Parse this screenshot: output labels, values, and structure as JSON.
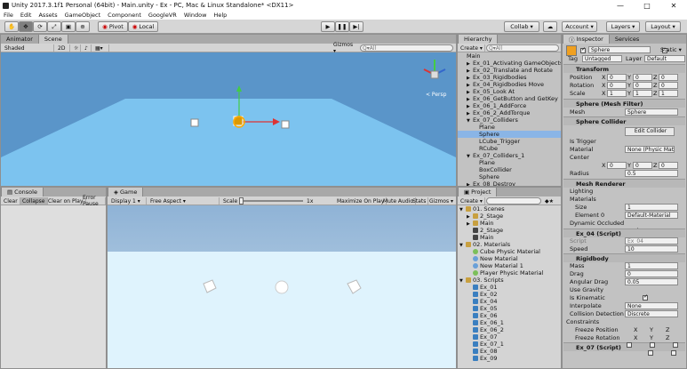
{
  "window": {
    "title": "Unity 2017.3.1f1 Personal (64bit) - Main.unity - Ex - PC, Mac & Linux Standalone* <DX11>"
  },
  "menu": [
    "File",
    "Edit",
    "Assets",
    "GameObject",
    "Component",
    "GoogleVR",
    "Window",
    "Help"
  ],
  "toolbar": {
    "pivot": "Pivot",
    "local": "Local",
    "collab": "Collab ▾",
    "account": "Account ▾",
    "layers": "Layers ▾",
    "layout": "Layout ▾"
  },
  "scene": {
    "tabs": [
      "Animator",
      "Scene"
    ],
    "shading": "Shaded",
    "mode2d": "2D",
    "gizmos": "Gizmos ▾",
    "search_placeholder": "Q▾All",
    "persp": "< Persp"
  },
  "console": {
    "tab": "Console",
    "buttons": [
      "Clear",
      "Collapse",
      "Clear on Play",
      "Error Pause"
    ]
  },
  "game": {
    "tab": "Game",
    "display": "Display 1 ▾",
    "aspect": "Free Aspect ▾",
    "scale_label": "Scale",
    "scale_value": "1x",
    "buttons": [
      "Maximize On Play",
      "Mute Audio",
      "Stats",
      "Gizmos ▾"
    ]
  },
  "hierarchy": {
    "tab": "Hierarchy",
    "create": "Create ▾",
    "search_placeholder": "Q▾All",
    "items": [
      {
        "label": "Main",
        "indent": 0,
        "arrow": ""
      },
      {
        "label": "Ex_01_Activating GameObjects",
        "indent": 1,
        "arrow": "▶"
      },
      {
        "label": "Ex_02_Translate and Rotate",
        "indent": 1,
        "arrow": "▶"
      },
      {
        "label": "Ex_03_Rigidbodies",
        "indent": 1,
        "arrow": "▶"
      },
      {
        "label": "Ex_04_Rigidbodies Move",
        "indent": 1,
        "arrow": "▶"
      },
      {
        "label": "Ex_05_Look At",
        "indent": 1,
        "arrow": "▶"
      },
      {
        "label": "Ex_06_GetButton and GetKey",
        "indent": 1,
        "arrow": "▶"
      },
      {
        "label": "Ex_06_1_AddForce",
        "indent": 1,
        "arrow": "▶"
      },
      {
        "label": "Ex_06_2_AddTorque",
        "indent": 1,
        "arrow": "▶"
      },
      {
        "label": "Ex_07_Colliders",
        "indent": 1,
        "arrow": "▼"
      },
      {
        "label": "Plane",
        "indent": 2,
        "arrow": ""
      },
      {
        "label": "Sphere",
        "indent": 2,
        "arrow": "",
        "selected": true
      },
      {
        "label": "LCube_Trigger",
        "indent": 2,
        "arrow": ""
      },
      {
        "label": "RCube",
        "indent": 2,
        "arrow": ""
      },
      {
        "label": "Ex_07_Colliders_1",
        "indent": 1,
        "arrow": "▼"
      },
      {
        "label": "Plane",
        "indent": 2,
        "arrow": ""
      },
      {
        "label": "BoxCollider",
        "indent": 2,
        "arrow": ""
      },
      {
        "label": "Sphere",
        "indent": 2,
        "arrow": ""
      },
      {
        "label": "Ex_08_Destroy",
        "indent": 1,
        "arrow": "▶"
      }
    ]
  },
  "project": {
    "tab": "Project",
    "create": "Create ▾",
    "items": [
      {
        "label": "01. Scenes",
        "indent": 0,
        "arrow": "▼",
        "kind": "folder"
      },
      {
        "label": "2_Stage",
        "indent": 1,
        "arrow": "▶",
        "kind": "folder"
      },
      {
        "label": "Main",
        "indent": 1,
        "arrow": "▶",
        "kind": "folder"
      },
      {
        "label": "2_Stage",
        "indent": 1,
        "arrow": "",
        "kind": "scene"
      },
      {
        "label": "Main",
        "indent": 1,
        "arrow": "",
        "kind": "scene"
      },
      {
        "label": "02. Materials",
        "indent": 0,
        "arrow": "▼",
        "kind": "folder"
      },
      {
        "label": "Cube Physic Material",
        "indent": 1,
        "arrow": "",
        "kind": "physic"
      },
      {
        "label": "New Material",
        "indent": 1,
        "arrow": "",
        "kind": "material"
      },
      {
        "label": "New Material 1",
        "indent": 1,
        "arrow": "",
        "kind": "material"
      },
      {
        "label": "Player Physic Material",
        "indent": 1,
        "arrow": "",
        "kind": "physic"
      },
      {
        "label": "03. Scripts",
        "indent": 0,
        "arrow": "▼",
        "kind": "folder"
      },
      {
        "label": "Ex_01",
        "indent": 1,
        "arrow": "",
        "kind": "script"
      },
      {
        "label": "Ex_02",
        "indent": 1,
        "arrow": "",
        "kind": "script"
      },
      {
        "label": "Ex_04",
        "indent": 1,
        "arrow": "",
        "kind": "script"
      },
      {
        "label": "Ex_05",
        "indent": 1,
        "arrow": "",
        "kind": "script"
      },
      {
        "label": "Ex_06",
        "indent": 1,
        "arrow": "",
        "kind": "script"
      },
      {
        "label": "Ex_06_1",
        "indent": 1,
        "arrow": "",
        "kind": "script"
      },
      {
        "label": "Ex_06_2",
        "indent": 1,
        "arrow": "",
        "kind": "script"
      },
      {
        "label": "Ex_07",
        "indent": 1,
        "arrow": "",
        "kind": "script"
      },
      {
        "label": "Ex_07_1",
        "indent": 1,
        "arrow": "",
        "kind": "script"
      },
      {
        "label": "Ex_08",
        "indent": 1,
        "arrow": "",
        "kind": "script"
      },
      {
        "label": "Ex_09",
        "indent": 1,
        "arrow": "",
        "kind": "script"
      }
    ]
  },
  "inspector": {
    "tabs": [
      "Inspector",
      "Services"
    ],
    "object_name": "Sphere",
    "static_label": "Static ▾",
    "tag_label": "Tag",
    "tag_value": "Untagged",
    "layer_label": "Layer",
    "layer_value": "Default",
    "transform": {
      "title": "Transform",
      "position_label": "Position",
      "rotation_label": "Rotation",
      "scale_label": "Scale",
      "position": [
        "0",
        "0",
        "0"
      ],
      "rotation": [
        "0",
        "0",
        "0"
      ],
      "scale": [
        "1",
        "1",
        "1"
      ]
    },
    "mesh_filter": {
      "title": "Sphere (Mesh Filter)",
      "mesh_label": "Mesh",
      "mesh_value": "Sphere"
    },
    "sphere_collider": {
      "title": "Sphere Collider",
      "edit": "Edit Collider",
      "is_trigger_label": "Is Trigger",
      "material_label": "Material",
      "material_value": "None (Physic Mate",
      "center_label": "Center",
      "center": [
        "0",
        "0",
        "0"
      ],
      "radius_label": "Radius",
      "radius": "0.5"
    },
    "mesh_renderer": {
      "title": "Mesh Renderer",
      "lighting": "Lighting",
      "materials": "Materials",
      "size_label": "Size",
      "size": "1",
      "element_label": "Element 0",
      "element_value": "Default-Material",
      "dynamic_label": "Dynamic Occluded"
    },
    "ex04": {
      "title": "Ex_04 (Script)",
      "script_label": "Script",
      "script_value": "Ex_04",
      "speed_label": "Speed",
      "speed": "10"
    },
    "rigidbody": {
      "title": "Rigidbody",
      "mass_label": "Mass",
      "mass": "1",
      "drag_label": "Drag",
      "drag": "0",
      "angular_label": "Angular Drag",
      "angular": "0.05",
      "gravity_label": "Use Gravity",
      "kinematic_label": "Is Kinematic",
      "interpolate_label": "Interpolate",
      "interpolate": "None",
      "collision_label": "Collision Detection",
      "collision": "Discrete",
      "constraints": "Constraints",
      "freeze_pos": "Freeze Position",
      "freeze_rot": "Freeze Rotation"
    },
    "ex07": {
      "title": "Ex_07 (Script)"
    }
  },
  "colors": {
    "sky": "#5a95c9",
    "plane": "#7cc3ef",
    "game_sky_top": "#8fb3d6",
    "game_ground": "#dff3fd",
    "selected": "#8ab5e6"
  }
}
